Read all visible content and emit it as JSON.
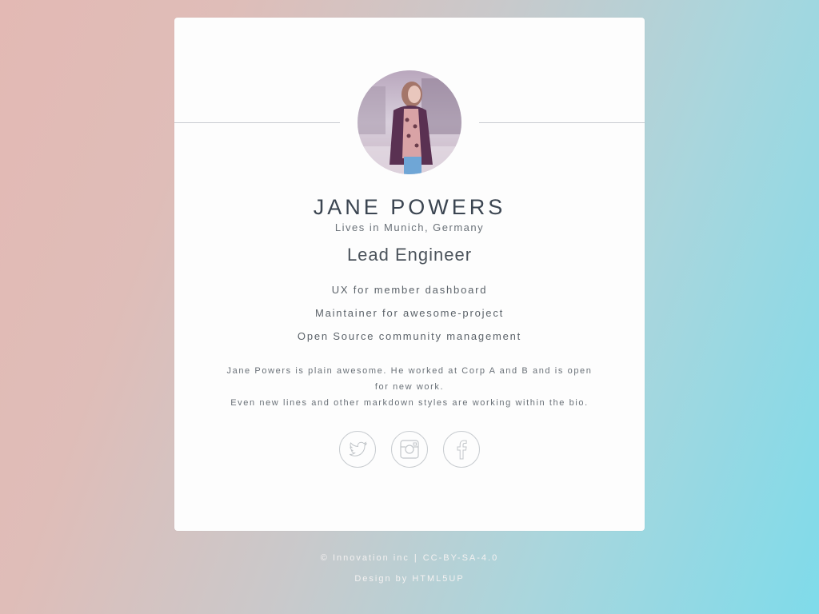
{
  "profile": {
    "name": "JANE POWERS",
    "location": "Lives in Munich, Germany",
    "role": "Lead Engineer",
    "responsibilities": [
      "UX for member dashboard",
      "Maintainer for awesome-project",
      "Open Source community management"
    ],
    "bio_lines": [
      "Jane Powers is plain awesome. He worked at Corp A and B and is open",
      "for new work.",
      "Even new lines and other markdown styles are working within the bio."
    ]
  },
  "socials": [
    {
      "name": "twitter",
      "icon": "twitter-icon"
    },
    {
      "name": "instagram",
      "icon": "instagram-icon"
    },
    {
      "name": "facebook",
      "icon": "facebook-icon"
    }
  ],
  "footer": {
    "copyright": "© Innovation inc",
    "license": "CC-BY-SA-4.0",
    "design_prefix": "Design by",
    "design_link": "HTML5UP"
  },
  "colors": {
    "card": "#fdfdfd",
    "text_dark": "#3b4551",
    "icon_stroke": "#c9cdd1",
    "gradient_left": "#e3b9b4",
    "gradient_right": "#7fdbea"
  }
}
